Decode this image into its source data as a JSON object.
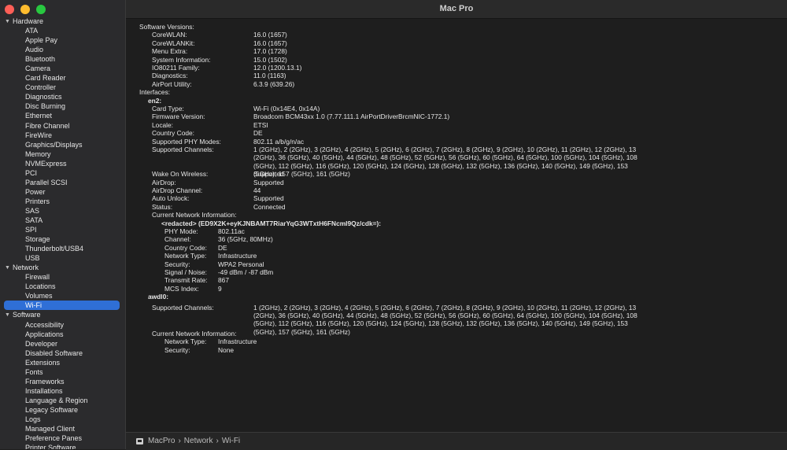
{
  "window": {
    "title": "Mac Pro"
  },
  "sidebar": {
    "groups": [
      {
        "label": "Hardware",
        "items": [
          "ATA",
          "Apple Pay",
          "Audio",
          "Bluetooth",
          "Camera",
          "Card Reader",
          "Controller",
          "Diagnostics",
          "Disc Burning",
          "Ethernet",
          "Fibre Channel",
          "FireWire",
          "Graphics/Displays",
          "Memory",
          "NVMExpress",
          "PCI",
          "Parallel SCSI",
          "Power",
          "Printers",
          "SAS",
          "SATA",
          "SPI",
          "Storage",
          "Thunderbolt/USB4",
          "USB"
        ]
      },
      {
        "label": "Network",
        "items": [
          "Firewall",
          "Locations",
          "Volumes",
          "Wi-Fi"
        ]
      },
      {
        "label": "Software",
        "items": [
          "Accessibility",
          "Applications",
          "Developer",
          "Disabled Software",
          "Extensions",
          "Fonts",
          "Frameworks",
          "Installations",
          "Language & Region",
          "Legacy Software",
          "Logs",
          "Managed Client",
          "Preference Panes",
          "Printer Software"
        ]
      }
    ],
    "selected": "Wi-Fi"
  },
  "content": {
    "software_versions_label": "Software Versions:",
    "software_versions": [
      {
        "k": "CoreWLAN:",
        "v": "16.0 (1657)"
      },
      {
        "k": "CoreWLANKit:",
        "v": "16.0 (1657)"
      },
      {
        "k": "Menu Extra:",
        "v": "17.0 (1728)"
      },
      {
        "k": "System Information:",
        "v": "15.0 (1502)"
      },
      {
        "k": "IO80211 Family:",
        "v": "12.0 (1200.13.1)"
      },
      {
        "k": "Diagnostics:",
        "v": "11.0 (1163)"
      },
      {
        "k": "AirPort Utility:",
        "v": "6.3.9 (639.26)"
      }
    ],
    "interfaces_label": "Interfaces:",
    "en2_label": "en2:",
    "en2": [
      {
        "k": "Card Type:",
        "v": "Wi-Fi  (0x14E4, 0x14A)"
      },
      {
        "k": "Firmware Version:",
        "v": "Broadcom BCM43xx 1.0 (7.77.111.1 AirPortDriverBrcmNIC-1772.1)"
      },
      {
        "k": "Locale:",
        "v": "ETSI"
      },
      {
        "k": "Country Code:",
        "v": "DE"
      },
      {
        "k": "Supported PHY Modes:",
        "v": "802.11 a/b/g/n/ac"
      },
      {
        "k": "Supported Channels:",
        "v": "1 (2GHz), 2 (2GHz), 3 (2GHz), 4 (2GHz), 5 (2GHz), 6 (2GHz), 7 (2GHz), 8 (2GHz), 9 (2GHz), 10 (2GHz), 11 (2GHz), 12 (2GHz), 13 (2GHz), 36 (5GHz), 40 (5GHz), 44 (5GHz), 48 (5GHz), 52 (5GHz), 56 (5GHz), 60 (5GHz), 64 (5GHz), 100 (5GHz), 104 (5GHz), 108 (5GHz), 112 (5GHz), 116 (5GHz), 120 (5GHz), 124 (5GHz), 128 (5GHz), 132 (5GHz), 136 (5GHz), 140 (5GHz), 149 (5GHz), 153 (5GHz), 157 (5GHz), 161 (5GHz)"
      },
      {
        "k": "Wake On Wireless:",
        "v": "Supported"
      },
      {
        "k": "AirDrop:",
        "v": "Supported"
      },
      {
        "k": "AirDrop Channel:",
        "v": "44"
      },
      {
        "k": "Auto Unlock:",
        "v": "Supported"
      },
      {
        "k": "Status:",
        "v": "Connected"
      }
    ],
    "current_network_label": "Current Network Information:",
    "redacted_label": "<redacted> (ED9X2K+eyKJNBAMT7RiarYqG3WTxtH6FNcml9Qz/cdk=):",
    "current_network": [
      {
        "k": "PHY Mode:",
        "v": "802.11ac"
      },
      {
        "k": "Channel:",
        "v": "36 (5GHz, 80MHz)"
      },
      {
        "k": "Country Code:",
        "v": "DE"
      },
      {
        "k": "Network Type:",
        "v": "Infrastructure"
      },
      {
        "k": "Security:",
        "v": "WPA2 Personal"
      },
      {
        "k": "Signal / Noise:",
        "v": "-49 dBm / -87 dBm"
      },
      {
        "k": "Transmit Rate:",
        "v": "867"
      },
      {
        "k": "MCS Index:",
        "v": "9"
      }
    ],
    "awdl_label": "awdl0:",
    "awdl_channels_key": "Supported Channels:",
    "awdl_channels_val": "1 (2GHz), 2 (2GHz), 3 (2GHz), 4 (2GHz), 5 (2GHz), 6 (2GHz), 7 (2GHz), 8 (2GHz), 9 (2GHz), 10 (2GHz), 11 (2GHz), 12 (2GHz), 13 (2GHz), 36 (5GHz), 40 (5GHz), 44 (5GHz), 48 (5GHz), 52 (5GHz), 56 (5GHz), 60 (5GHz), 64 (5GHz), 100 (5GHz), 104 (5GHz), 108 (5GHz), 112 (5GHz), 116 (5GHz), 120 (5GHz), 124 (5GHz), 128 (5GHz), 132 (5GHz), 136 (5GHz), 140 (5GHz), 149 (5GHz), 153 (5GHz), 157 (5GHz), 161 (5GHz)",
    "awdl_current_label": "Current Network Information:",
    "awdl_current": [
      {
        "k": "Network Type:",
        "v": "Infrastructure"
      },
      {
        "k": "Security:",
        "v": "None"
      }
    ]
  },
  "statusbar": {
    "crumbs": [
      "MacPro",
      "›",
      "Network",
      "›",
      "Wi-Fi"
    ]
  }
}
